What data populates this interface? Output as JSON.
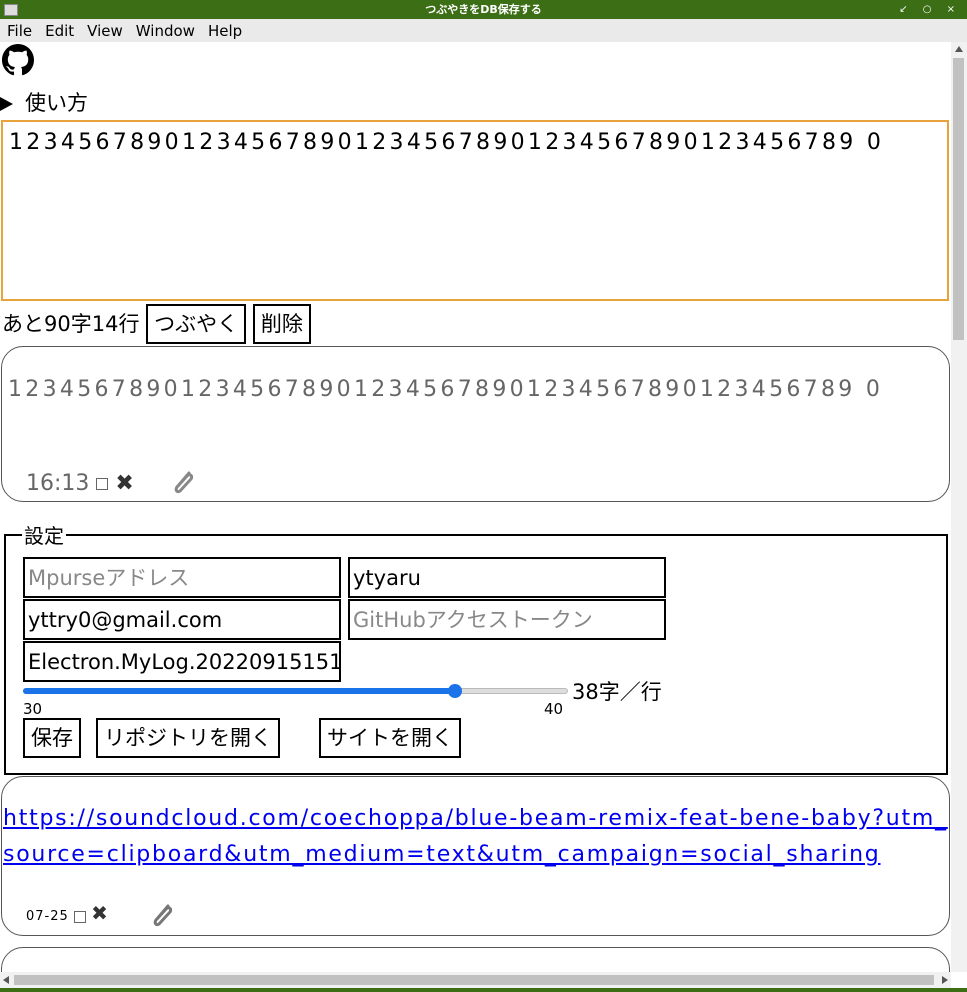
{
  "window": {
    "title": "つぶやきをDB保存する",
    "controls": "↙ ○ ×"
  },
  "menu": [
    "File",
    "Edit",
    "View",
    "Window",
    "Help"
  ],
  "howto": {
    "label": "使い方"
  },
  "editor": {
    "text": "1234567890123456789012345678901234567890123456789 0"
  },
  "composer": {
    "remaining": "あと90字14行",
    "post_label": "つぶやく",
    "delete_label": "削除"
  },
  "posts": [
    {
      "text": "1234567890123456789012345678901234567890123456789 0",
      "time": "16:13",
      "delete_glyph": "✖"
    },
    {
      "url": "https://soundcloud.com/coechoppa/blue-beam-remix-feat-bene-baby?utm_source=clipboard&utm_medium=text&utm_campaign=social_sharing",
      "time": "07-25",
      "delete_glyph": "✖"
    }
  ],
  "settings": {
    "legend": "設定",
    "mpurse_placeholder": "Mpurseアドレス",
    "github_user": "ytyaru",
    "email": "yttry0@gmail.com",
    "token_placeholder": "GitHubアクセストークン",
    "repo_name": "Electron.MyLog.20220915151",
    "slider": {
      "min": "30",
      "max": "40",
      "value": 38,
      "value_label": "38字／行"
    },
    "save_label": "保存",
    "open_repo_label": "リポジトリを開く",
    "open_site_label": "サイトを開く"
  },
  "colors": {
    "titlebar": "#3b6e15",
    "editor_border": "#e8a33a",
    "accent": "#1a73e8",
    "link": "#0000ee"
  }
}
